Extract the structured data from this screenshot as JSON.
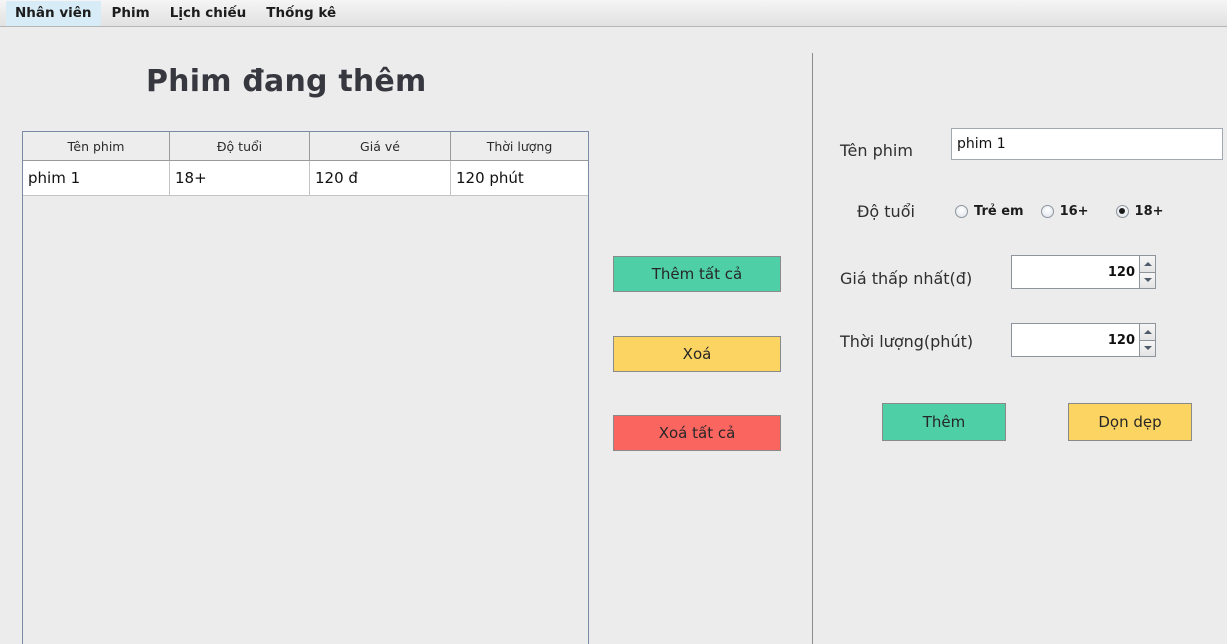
{
  "menubar": {
    "items": [
      {
        "label": "Nhân viên",
        "hovered": true
      },
      {
        "label": "Phim",
        "hovered": false
      },
      {
        "label": "Lịch chiếu",
        "hovered": false
      },
      {
        "label": "Thống kê",
        "hovered": false
      }
    ]
  },
  "title": "Phim đang thêm",
  "table": {
    "columns": [
      "Tên phim",
      "Độ tuổi",
      "Giá vé",
      "Thời lượng"
    ],
    "rows": [
      [
        "phim 1",
        "18+",
        "120 đ",
        "120 phút"
      ]
    ]
  },
  "center_buttons": {
    "add_all": "Thêm tất cả",
    "delete": "Xoá",
    "delete_all": "Xoá tất cả"
  },
  "form": {
    "name_label": "Tên phim",
    "name_value": "phim 1",
    "name_placeholder": "",
    "age_label": "Độ tuổi",
    "age_options": [
      {
        "label": "Trẻ em",
        "checked": false
      },
      {
        "label": "16+",
        "checked": false
      },
      {
        "label": "18+",
        "checked": true
      }
    ],
    "price_label": "Giá thấp nhất(đ)",
    "price_value": "120",
    "duration_label": "Thời lượng(phút)",
    "duration_value": "120",
    "submit_label": "Thêm",
    "clear_label": "Dọn dẹp"
  },
  "colors": {
    "background": "#ececec",
    "green": "#4ecfa5",
    "yellow": "#fcd462",
    "red": "#fb6560",
    "title_text": "#37373f",
    "divider": "#8c8c8c"
  }
}
